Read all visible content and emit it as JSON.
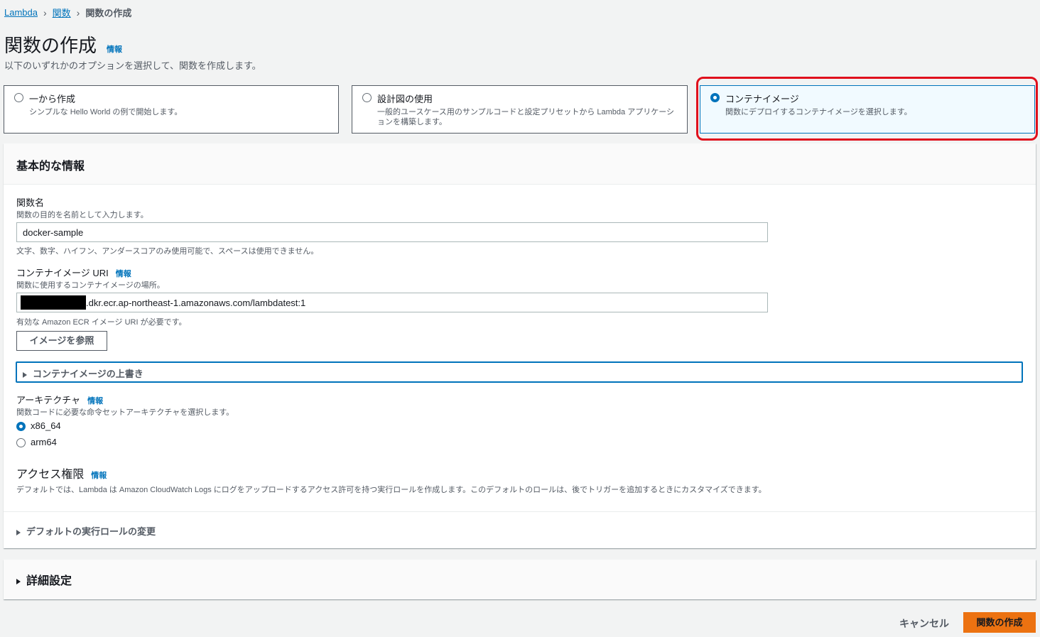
{
  "breadcrumb": {
    "root": "Lambda",
    "functions": "関数",
    "current": "関数の作成"
  },
  "header": {
    "title": "関数の作成",
    "info": "情報",
    "subtitle": "以下のいずれかのオプションを選択して、関数を作成します。"
  },
  "options": [
    {
      "title": "一から作成",
      "desc": "シンプルな Hello World の例で開始します。",
      "selected": false
    },
    {
      "title": "設計図の使用",
      "desc": "一般的ユースケース用のサンプルコードと設定プリセットから Lambda アプリケーションを構築します。",
      "selected": false
    },
    {
      "title": "コンテナイメージ",
      "desc": "関数にデプロイするコンテナイメージを選択します。",
      "selected": true
    }
  ],
  "basic": {
    "header": "基本的な情報",
    "function_name": {
      "label": "関数名",
      "desc": "関数の目的を名前として入力します。",
      "value": "docker-sample",
      "hint": "文字、数字、ハイフン、アンダースコアのみ使用可能で、スペースは使用できません。"
    },
    "image_uri": {
      "label": "コンテナイメージ URI",
      "info": "情報",
      "desc": "関数に使用するコンテナイメージの場所。",
      "value": ".dkr.ecr.ap-northeast-1.amazonaws.com/lambdatest:1",
      "hint": "有効な Amazon ECR イメージ URI が必要です。",
      "browse": "イメージを参照"
    },
    "override": "コンテナイメージの上書き",
    "architecture": {
      "label": "アーキテクチャ",
      "info": "情報",
      "desc": "関数コードに必要な命令セットアーキテクチャを選択します。",
      "options": [
        "x86_64",
        "arm64"
      ],
      "selected": "x86_64"
    },
    "permissions": {
      "heading": "アクセス権限",
      "info": "情報",
      "desc": "デフォルトでは、Lambda は Amazon CloudWatch Logs にログをアップロードするアクセス許可を持つ実行ロールを作成します。このデフォルトのロールは、後でトリガーを追加するときにカスタマイズできます。",
      "change_role": "デフォルトの実行ロールの変更"
    }
  },
  "advanced": {
    "header": "詳細設定"
  },
  "footer": {
    "cancel": "キャンセル",
    "create": "関数の作成"
  },
  "colors": {
    "accent": "#0073bb",
    "primary_button": "#ec7211",
    "highlight": "#e0101c"
  }
}
